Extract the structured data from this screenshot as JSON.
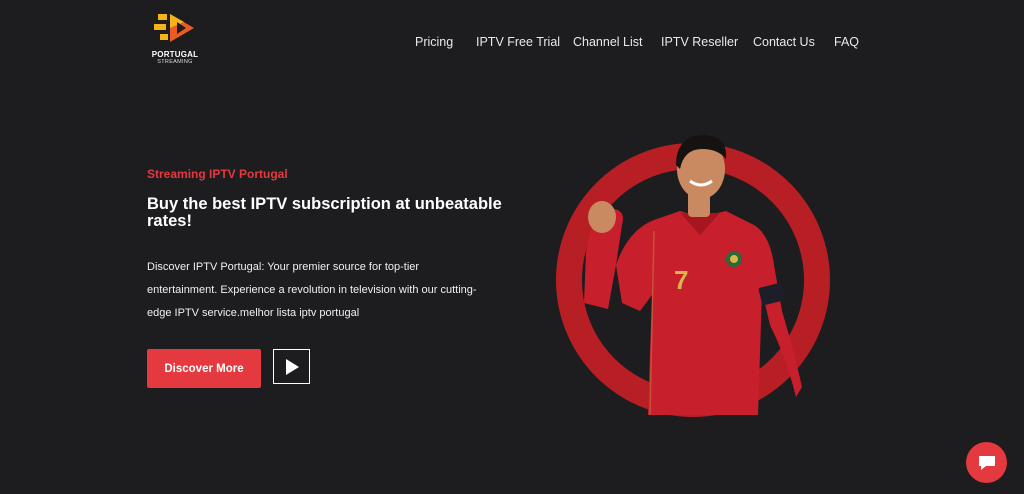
{
  "brand": {
    "logo_text": "PORTUGAL",
    "logo_subtext": "STREAMING"
  },
  "nav": {
    "items": [
      "Pricing",
      "IPTV Free Trial",
      "Channel List",
      "IPTV Reseller",
      "Contact Us",
      "FAQ"
    ]
  },
  "hero": {
    "eyebrow": "Streaming IPTV Portugal",
    "headline": "Buy the best IPTV subscription at unbeatable rates!",
    "description": "Discover IPTV Portugal: Your premier source for top-tier entertainment. Experience a revolution in television with our cutting-edge IPTV service.melhor lista iptv portugal",
    "discover_button": "Discover More",
    "jersey_number": "7"
  },
  "icons": {
    "play": "play-icon",
    "chat": "chat-icon",
    "logo": "play-logo-icon"
  },
  "colors": {
    "background": "#1d1c1e",
    "accent": "#e4393e",
    "ring": "#b71f24",
    "logo_yellow": "#f5b21b",
    "logo_orange": "#ee5a26"
  }
}
